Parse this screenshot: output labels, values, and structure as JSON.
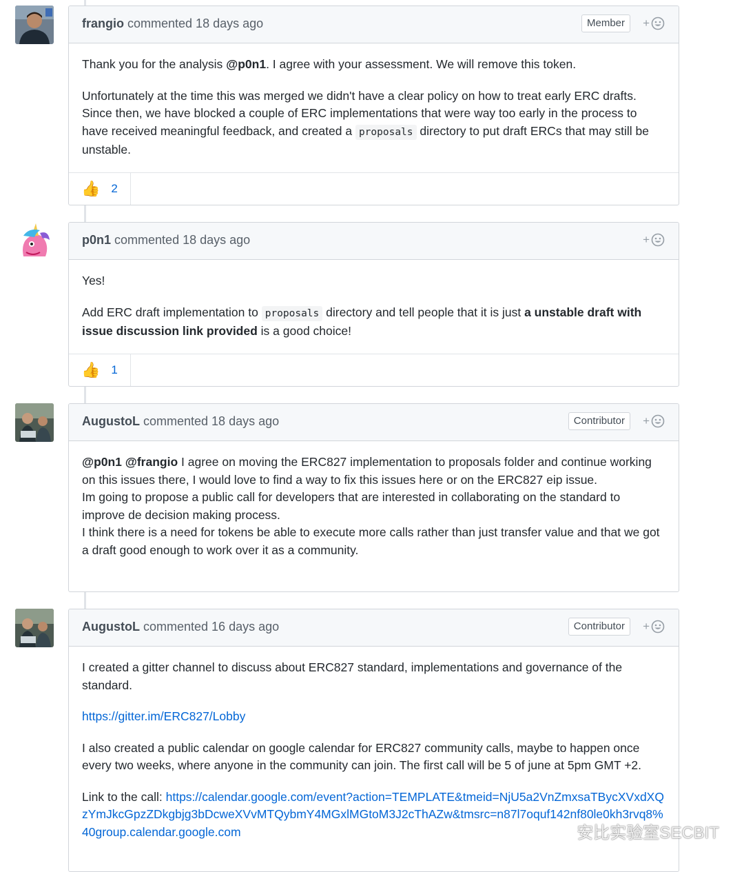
{
  "comments": [
    {
      "author": "frangio",
      "meta": "commented 18 days ago",
      "badge": "Member",
      "paragraphs": {
        "p1_pre": "Thank you for the analysis ",
        "p1_mention": "@p0n1",
        "p1_post": ". I agree with your assessment. We will remove this token.",
        "p2_pre": "Unfortunately at the time this was merged we didn't have a clear policy on how to treat early ERC drafts. Since then, we have blocked a couple of ERC implementations that were way too early in the process to have received meaningful feedback, and created a ",
        "p2_code": "proposals",
        "p2_post": " directory to put draft ERCs that may still be unstable."
      },
      "reaction": {
        "emoji": "👍",
        "count": "2"
      }
    },
    {
      "author": "p0n1",
      "meta": "commented 18 days ago",
      "paragraphs": {
        "p1": "Yes!",
        "p2_pre": "Add ERC draft implementation to ",
        "p2_code": "proposals",
        "p2_mid": " directory and tell people that it is just ",
        "p2_bold": "a unstable draft with issue discussion link provided",
        "p2_post": " is a good choice!"
      },
      "reaction": {
        "emoji": "👍",
        "count": "1"
      }
    },
    {
      "author": "AugustoL",
      "meta": "commented 18 days ago",
      "badge": "Contributor",
      "paragraphs": {
        "mention": "@p0n1 @frangio",
        "l1": " I agree on moving the ERC827 implementation to proposals folder and continue working on this issues there, I would love to find a way to fix this issues here or on the ERC827 eip issue.",
        "l2": "Im going to propose a public call for developers that are interested in collaborating on the standard to improve de decision making process.",
        "l3": "I think there is a need for tokens be able to execute more calls rather than just transfer value and that we got a draft good enough to work over it as a community."
      }
    },
    {
      "author": "AugustoL",
      "meta": "commented 16 days ago",
      "badge": "Contributor",
      "paragraphs": {
        "p1": "I created a gitter channel to discuss about ERC827 standard, implementations and governance of the standard.",
        "p2_link": "https://gitter.im/ERC827/Lobby",
        "p3": "I also created a public calendar on google calendar for ERC827 community calls, maybe to happen once every two weeks, where anyone in the community can join. The first call will be 5 of june at 5pm GMT +2.",
        "p4_pre": "Link to the call: ",
        "p4_link": "https://calendar.google.com/event?action=TEMPLATE&tmeid=NjU5a2VnZmxsaTBycXVxdXQzYmJkcGpzZDkgbjg3bDcweXVvMTQybmY4MGxlMGtoM3J2cThAZw&tmsrc=n87l7oquf142nf80le0kh3rvq8%40group.calendar.google.com"
      }
    }
  ],
  "watermark": "安比实验室SECBIT",
  "colors": {
    "link": "#0366d6",
    "header_bg": "#f6f8fa",
    "border": "#d1d5da"
  }
}
